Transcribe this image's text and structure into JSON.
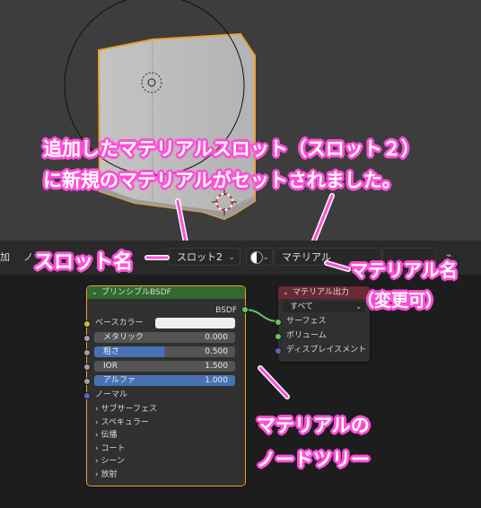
{
  "header": {
    "add_menu": "加",
    "other_menu": "ノ",
    "slot_dropdown": "スロット2",
    "material_field": "マテリアル"
  },
  "bsdf_node": {
    "title": "プリンシプルBSDF",
    "output": "BSDF",
    "base_color_label": "ベースカラー",
    "fields": [
      {
        "label": "メタリック",
        "value": "0.000"
      },
      {
        "label": "粗さ",
        "value": "0.500"
      },
      {
        "label": "IOR",
        "value": "1.500"
      },
      {
        "label": "アルファ",
        "value": "1.000"
      }
    ],
    "normal_label": "ノーマル",
    "panels": [
      "サブサーフェス",
      "スペキュラー",
      "伝播",
      "コート",
      "シーン",
      "放射"
    ]
  },
  "output_node": {
    "title": "マテリアル出力",
    "target": "すべて",
    "inputs": [
      "サーフェス",
      "ボリューム",
      "ディスプレイスメント"
    ]
  },
  "annotations": {
    "top_line1": "追加したマテリアルスロット（スロット２）",
    "top_line2": "に新規のマテリアルがセットされました。",
    "slot_name": "スロット名",
    "material_name": "マテリアル名",
    "material_note": "（変更可）",
    "tree_line1": "マテリアルの",
    "tree_line2": "ノードツリー"
  },
  "colors": {
    "annotation_pink": "#ff4fd8",
    "selection_orange": "#f0a030",
    "bsdf_header": "#2f6a2f",
    "output_header": "#6a2a33",
    "field_blue": "#4772b3",
    "socket_yellow": "#c7c729",
    "socket_grey": "#a1a1a1",
    "socket_green": "#63c763",
    "socket_blue": "#6363c7"
  }
}
